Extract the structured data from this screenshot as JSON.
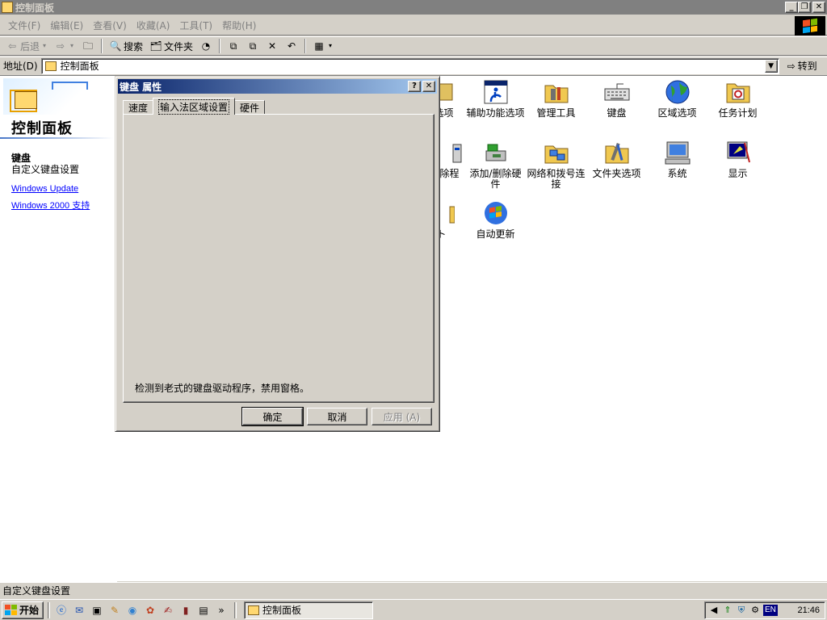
{
  "window": {
    "title": "控制面板",
    "controls": [
      "_",
      "❐",
      "✕"
    ]
  },
  "menubar": {
    "items": [
      "文件(F)",
      "编辑(E)",
      "查看(V)",
      "收藏(A)",
      "工具(T)",
      "帮助(H)"
    ]
  },
  "toolbar": {
    "back": "后退",
    "search": "搜索",
    "folders": "文件夹"
  },
  "addressbar": {
    "label": "地址(D)",
    "value": "控制面板",
    "go": "转到"
  },
  "leftpane": {
    "title": "控制面板",
    "selected_name": "键盘",
    "selected_desc": "自定义键盘设置",
    "links": [
      "Windows Update",
      "Windows 2000 支持"
    ]
  },
  "icons": [
    {
      "label": "选项",
      "icon": "partially-hidden-icon"
    },
    {
      "label": "辅助功能选项",
      "icon": "accessibility-icon"
    },
    {
      "label": "管理工具",
      "icon": "admin-tools-icon"
    },
    {
      "label": "键盘",
      "icon": "keyboard-icon"
    },
    {
      "label": "区域选项",
      "icon": "globe-icon"
    },
    {
      "label": "任务计划",
      "icon": "scheduled-tasks-icon"
    },
    {
      "label": "除程",
      "icon": "partially-hidden-icon"
    },
    {
      "label": "添加/删除硬件",
      "icon": "add-hardware-icon"
    },
    {
      "label": "网络和拨号连接",
      "icon": "network-icon"
    },
    {
      "label": "文件夹选项",
      "icon": "folder-options-icon"
    },
    {
      "label": "系统",
      "icon": "system-icon"
    },
    {
      "label": "显示",
      "icon": "display-icon"
    },
    {
      "label": "ト",
      "icon": "partially-hidden-icon"
    },
    {
      "label": "自动更新",
      "icon": "windows-update-icon"
    }
  ],
  "dialog": {
    "title": "键盘 属性",
    "help": "?",
    "close": "✕",
    "tabs": [
      "速度",
      "输入法区域设置",
      "硬件"
    ],
    "active_tab": "输入法区域设置",
    "message": "检测到老式的键盘驱动程序，禁用窗格。",
    "ok": "确定",
    "cancel": "取消",
    "apply": "应用 (A)"
  },
  "statusbar": {
    "text": "自定义键盘设置"
  },
  "taskbar": {
    "start": "开始",
    "quicklaunch_more": "»",
    "task": "控制面板",
    "lang": "EN",
    "clock": "21:46"
  },
  "colors": {
    "face": "#d4d0c8",
    "title_active_start": "#0a246a",
    "title_active_end": "#a6caf0",
    "title_inactive": "#808080",
    "link": "#0000ff"
  }
}
